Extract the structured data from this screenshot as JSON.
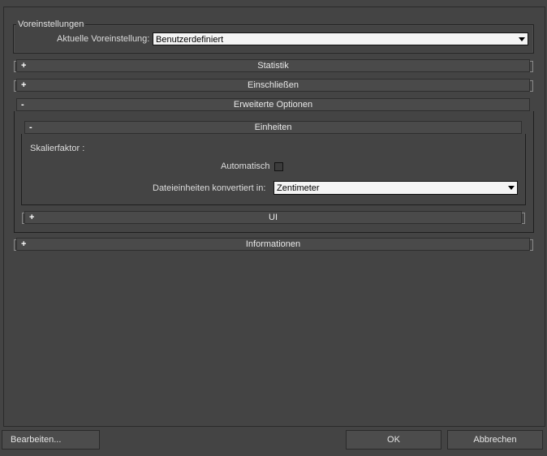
{
  "presets": {
    "legend": "Voreinstellungen",
    "current_label": "Aktuelle Voreinstellung:",
    "current_value": "Benutzerdefiniert"
  },
  "rollouts": {
    "statistik": {
      "sign": "+",
      "label": "Statistik"
    },
    "einschliessen": {
      "sign": "+",
      "label": "Einschließen"
    },
    "erweitert": {
      "sign": "-",
      "label": "Erweiterte Optionen"
    },
    "einheiten": {
      "sign": "-",
      "label": "Einheiten"
    },
    "ui": {
      "sign": "+",
      "label": "UI"
    },
    "informationen": {
      "sign": "+",
      "label": "Informationen"
    }
  },
  "units": {
    "scale_label": "Skalierfaktor :",
    "auto_label": "Automatisch",
    "auto_checked": false,
    "convert_label": "Dateieinheiten konvertiert in:",
    "convert_value": "Zentimeter"
  },
  "buttons": {
    "edit": "Bearbeiten...",
    "ok": "OK",
    "cancel": "Abbrechen"
  }
}
